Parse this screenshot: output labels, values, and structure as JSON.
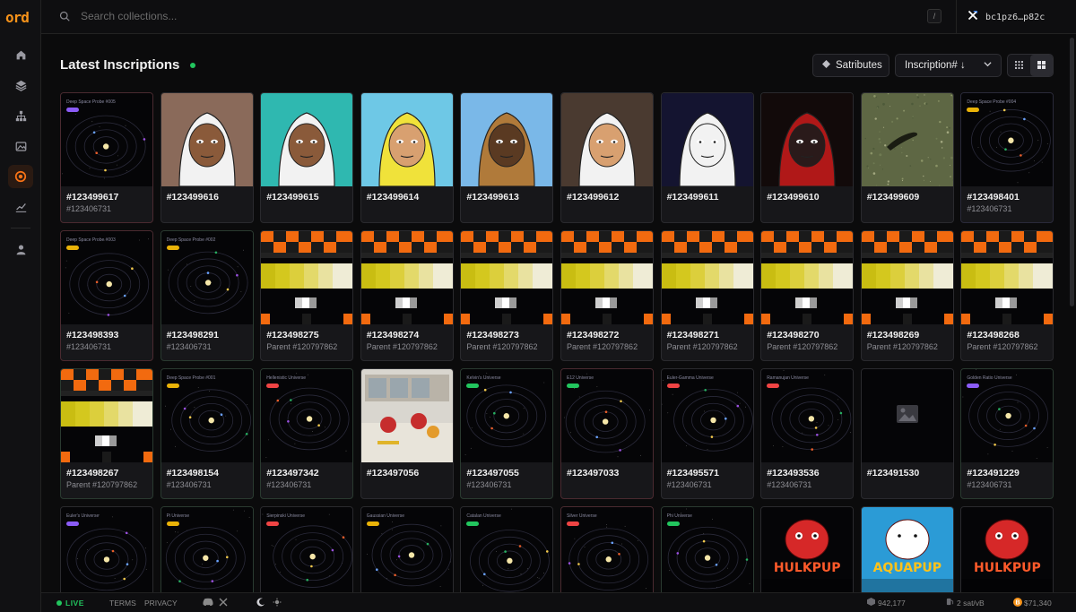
{
  "app": {
    "logo": "ord"
  },
  "sidebar": {
    "items": [
      {
        "name": "home-icon"
      },
      {
        "name": "layers-icon"
      },
      {
        "name": "hierarchy-icon"
      },
      {
        "name": "gallery-icon"
      },
      {
        "name": "ord-circle-icon",
        "active": true
      },
      {
        "name": "chart-icon"
      },
      {
        "name": "user-icon"
      }
    ]
  },
  "search": {
    "placeholder": "Search collections...",
    "shortcut": "/"
  },
  "wallet": {
    "address": "bc1pz6…p82c"
  },
  "header": {
    "title": "Latest Inscriptions",
    "attributes_label": "Satributes",
    "sort_label": "Inscription# ↓"
  },
  "inscriptions": [
    {
      "id": "#123499617",
      "sub": "#123406731",
      "thumb": "space",
      "title": "Deep Space Probe #005",
      "tag": "#8b5cf6",
      "border": "#4a2a30"
    },
    {
      "id": "#123499616",
      "sub": "",
      "thumb": "hood",
      "bg": "#8a6a5a",
      "hood": "#f2f2f2",
      "skin": "#8a5a3a",
      "border": "#2a2a2e"
    },
    {
      "id": "#123499615",
      "sub": "",
      "thumb": "hood",
      "bg": "#2fb8b0",
      "hood": "#f2f2f2",
      "skin": "#8a5a3a",
      "border": "#2a2a2e"
    },
    {
      "id": "#123499614",
      "sub": "",
      "thumb": "hood",
      "bg": "#6ec8e6",
      "hood": "#f0e23a",
      "skin": "#d8a070",
      "border": "#2a2a2e"
    },
    {
      "id": "#123499613",
      "sub": "",
      "thumb": "hood",
      "bg": "#7ab8e8",
      "hood": "#b07a3a",
      "skin": "#5a3a22",
      "border": "#2a2a2e"
    },
    {
      "id": "#123499612",
      "sub": "",
      "thumb": "hood",
      "bg": "#4a3a30",
      "hood": "#f2f2f2",
      "skin": "#d8a070",
      "border": "#2a2a2e"
    },
    {
      "id": "#123499611",
      "sub": "",
      "thumb": "hood",
      "bg": "#141430",
      "hood": "#f2f2f2",
      "skin": "#f2f2f2",
      "border": "#2a2a2e"
    },
    {
      "id": "#123499610",
      "sub": "",
      "thumb": "hood",
      "bg": "#120a0a",
      "hood": "#b01818",
      "skin": "#2a1a1a",
      "border": "#2a2a2e"
    },
    {
      "id": "#123499609",
      "sub": "",
      "thumb": "moss",
      "border": "#2a2a2e"
    },
    {
      "id": "#123498401",
      "sub": "#123406731",
      "thumb": "space",
      "title": "Deep Space Probe #004",
      "tag": "#eab308",
      "border": "#2a2a3a"
    },
    {
      "id": "#123498393",
      "sub": "#123406731",
      "thumb": "space",
      "title": "Deep Space Probe #003",
      "tag": "#eab308",
      "border": "#4a2a30"
    },
    {
      "id": "#123498291",
      "sub": "#123406731",
      "thumb": "space",
      "title": "Deep Space Probe #002",
      "tag": "#eab308",
      "border": "#2a3a30"
    },
    {
      "id": "#123498275",
      "sub": "Parent #120797862",
      "thumb": "pixel",
      "border": "#2a2a2e"
    },
    {
      "id": "#123498274",
      "sub": "Parent #120797862",
      "thumb": "pixel",
      "border": "#2a2a2e"
    },
    {
      "id": "#123498273",
      "sub": "Parent #120797862",
      "thumb": "pixel",
      "border": "#2a2a2e"
    },
    {
      "id": "#123498272",
      "sub": "Parent #120797862",
      "thumb": "pixel",
      "border": "#2a2a2e"
    },
    {
      "id": "#123498271",
      "sub": "Parent #120797862",
      "thumb": "pixel",
      "border": "#2a2a2e"
    },
    {
      "id": "#123498270",
      "sub": "Parent #120797862",
      "thumb": "pixel",
      "border": "#2a2a2e"
    },
    {
      "id": "#123498269",
      "sub": "Parent #120797862",
      "thumb": "pixel",
      "border": "#2a2a2e"
    },
    {
      "id": "#123498268",
      "sub": "Parent #120797862",
      "thumb": "pixel",
      "border": "#2a2a2e"
    },
    {
      "id": "#123498267",
      "sub": "Parent #120797862",
      "thumb": "pixel",
      "border": "#2a3a30"
    },
    {
      "id": "#123498154",
      "sub": "#123406731",
      "thumb": "space",
      "title": "Deep Space Probe #001",
      "tag": "#eab308",
      "border": "#2a3a30"
    },
    {
      "id": "#123497342",
      "sub": "#123406731",
      "thumb": "space",
      "title": "Hellenistic Universe",
      "tag": "#ef4444",
      "border": "#2a3a30"
    },
    {
      "id": "#123497056",
      "sub": "",
      "thumb": "kitchen",
      "border": "#2a2a2e"
    },
    {
      "id": "#123497055",
      "sub": "#123406731",
      "thumb": "space",
      "title": "Kelvin's Universe",
      "tag": "#22c55e",
      "border": "#2a3a30"
    },
    {
      "id": "#123497033",
      "sub": "",
      "thumb": "space",
      "title": "E12 Universe",
      "tag": "#22c55e",
      "border": "#4a2a30"
    },
    {
      "id": "#123495571",
      "sub": "#123406731",
      "thumb": "space",
      "title": "Euler-Gamma Universe",
      "tag": "#ef4444",
      "border": "#2a2a2e"
    },
    {
      "id": "#123493536",
      "sub": "#123406731",
      "thumb": "space",
      "title": "Ramanujan Universe",
      "tag": "#ef4444",
      "border": "#2a2a2e"
    },
    {
      "id": "#123491530",
      "sub": "",
      "thumb": "blank",
      "border": "#2a2a2e"
    },
    {
      "id": "#123491229",
      "sub": "#123406731",
      "thumb": "space",
      "title": "Golden Ratio Universe",
      "tag": "#8b5cf6",
      "border": "#2a3a30"
    },
    {
      "id": "",
      "sub": "",
      "thumb": "space",
      "title": "Euler's Universe",
      "tag": "#8b5cf6",
      "border": "#2a2a2e"
    },
    {
      "id": "",
      "sub": "",
      "thumb": "space",
      "title": "Pi Universe",
      "tag": "#eab308",
      "border": "#2a3a30"
    },
    {
      "id": "",
      "sub": "",
      "thumb": "space",
      "title": "Sierpinski Universe",
      "tag": "#ef4444",
      "border": "#2a2a2e"
    },
    {
      "id": "",
      "sub": "",
      "thumb": "space",
      "title": "Gaussian Universe",
      "tag": "#eab308",
      "border": "#2a2a2e"
    },
    {
      "id": "",
      "sub": "",
      "thumb": "space",
      "title": "Catalan Universe",
      "tag": "#22c55e",
      "border": "#2a2a2e"
    },
    {
      "id": "",
      "sub": "",
      "thumb": "space",
      "title": "Silver Universe",
      "tag": "#ef4444",
      "border": "#4a2a30"
    },
    {
      "id": "",
      "sub": "",
      "thumb": "space",
      "title": "Phi Universe",
      "tag": "#22c55e",
      "border": "#2a3a30"
    },
    {
      "id": "",
      "sub": "",
      "thumb": "pup",
      "title": "HULKPUP",
      "border": "#2a2a2e"
    },
    {
      "id": "",
      "sub": "",
      "thumb": "pupblue",
      "title": "AQUAPUP",
      "border": "#2a2a2e"
    },
    {
      "id": "",
      "sub": "",
      "thumb": "pup",
      "title": "HULKPUP",
      "border": "#2a2a2e"
    }
  ],
  "footer": {
    "live": "LIVE",
    "terms": "TERMS",
    "privacy": "PRIVACY",
    "block_height": "942,177",
    "fee": "2 sat/vB",
    "btc_price": "$71,340"
  }
}
